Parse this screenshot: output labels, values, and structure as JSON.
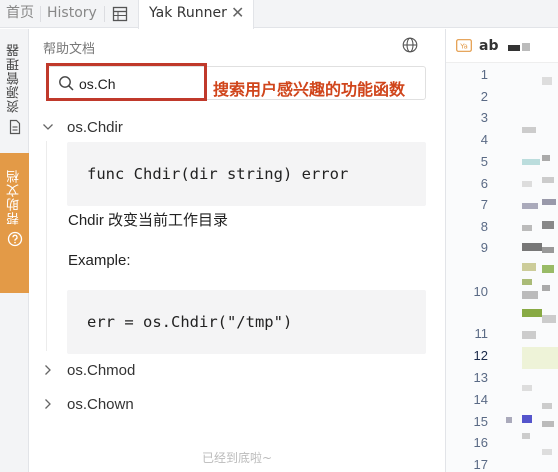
{
  "tabs": {
    "home": "首页",
    "history": "History",
    "active": "Yak Runner",
    "close": "✕"
  },
  "rail": {
    "resources": "资源管理器",
    "docs": "帮助文档"
  },
  "docs_panel": {
    "title": "帮助文档",
    "search_value": "os.Ch",
    "annotation": "搜索用户感兴趣的功能函数",
    "entries": [
      {
        "name": "os.Chdir",
        "expanded": true,
        "signature": "func Chdir(dir string) error",
        "description": "Chdir 改变当前工作目录",
        "example_label": "Example:",
        "example_code": "err = os.Chdir(\"/tmp\")"
      },
      {
        "name": "os.Chmod",
        "expanded": false
      },
      {
        "name": "os.Chown",
        "expanded": false
      }
    ],
    "footer": "已经到底啦~"
  },
  "editor": {
    "file_tab": "ab",
    "line_numbers": [
      "1",
      "2",
      "3",
      "4",
      "5",
      "6",
      "7",
      "8",
      "9",
      "10",
      "11",
      "12",
      "13",
      "14",
      "15",
      "16",
      "17"
    ],
    "active_line": "12"
  },
  "colors": {
    "accent": "#e39a47",
    "annotation": "#d0451b",
    "highlight_border": "#c0392b"
  }
}
